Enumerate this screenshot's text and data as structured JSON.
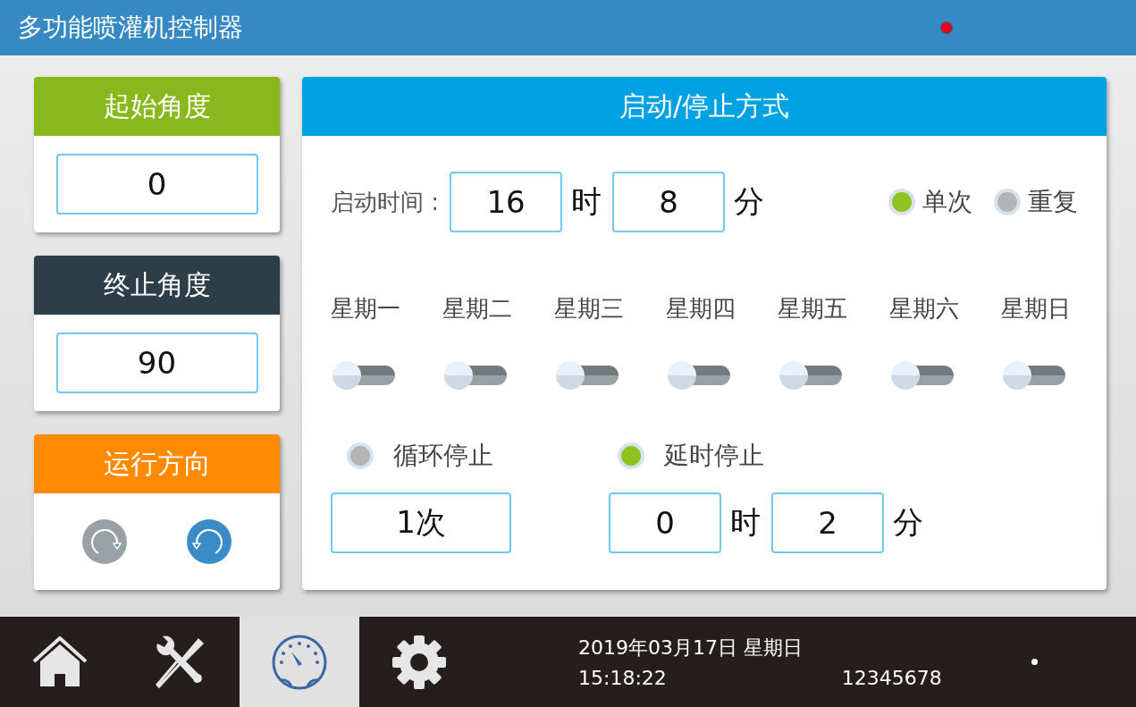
{
  "header": {
    "title": "多功能喷灌机控制器"
  },
  "start_angle": {
    "title": "起始角度",
    "value": "0"
  },
  "end_angle": {
    "title": "终止角度",
    "value": "90"
  },
  "direction": {
    "title": "运行方向",
    "options": [
      {
        "kind": "clockwise",
        "selected": false
      },
      {
        "kind": "counterclockwise",
        "selected": true
      }
    ]
  },
  "mode_panel": {
    "title": "启动/停止方式",
    "start_time": {
      "label": "启动时间 :",
      "hour": "16",
      "hour_unit": "时",
      "minute": "8",
      "minute_unit": "分"
    },
    "repeat_options": [
      {
        "label": "单次",
        "selected": true
      },
      {
        "label": "重复",
        "selected": false
      }
    ],
    "weekdays": [
      {
        "label": "星期一",
        "on": false
      },
      {
        "label": "星期二",
        "on": false
      },
      {
        "label": "星期三",
        "on": false
      },
      {
        "label": "星期四",
        "on": false
      },
      {
        "label": "星期五",
        "on": false
      },
      {
        "label": "星期六",
        "on": false
      },
      {
        "label": "星期日",
        "on": false
      }
    ],
    "stop_options": [
      {
        "label": "循环停止",
        "selected": false
      },
      {
        "label": "延时停止",
        "selected": true
      }
    ],
    "cycle_count": "1次",
    "delay": {
      "hour": "0",
      "hour_unit": "时",
      "minute": "2",
      "minute_unit": "分"
    }
  },
  "nav": [
    {
      "kind": "home",
      "selected": false
    },
    {
      "kind": "tools",
      "selected": false
    },
    {
      "kind": "gauge",
      "selected": true
    },
    {
      "kind": "settings",
      "selected": false
    }
  ],
  "status": {
    "date": "2019年03月17日 星期日",
    "time": "15:18:22",
    "code": "12345678"
  }
}
